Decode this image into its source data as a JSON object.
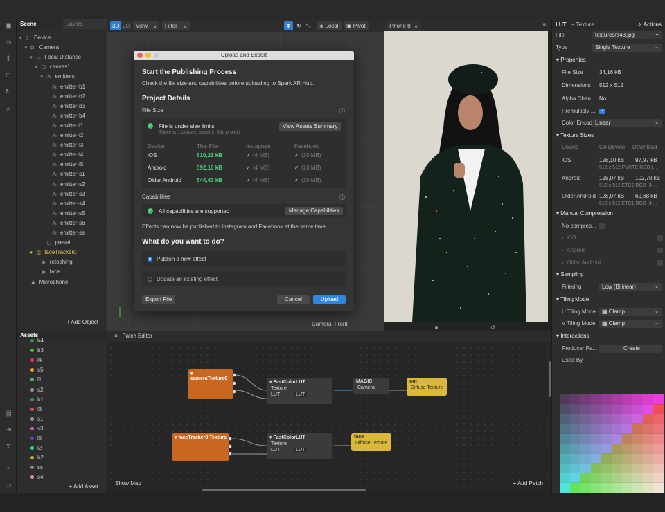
{
  "scene": {
    "tab_scene": "Scene",
    "tab_layers": "Layers",
    "add_object": "+ Add Object",
    "tree": [
      {
        "label": "Device",
        "icon": "device-icon",
        "indent": 0,
        "caret": "▾"
      },
      {
        "label": "Camera",
        "icon": "camera-icon",
        "indent": 1,
        "caret": "▾"
      },
      {
        "label": "Focal Distance",
        "icon": "focal-icon",
        "indent": 2,
        "caret": "▾"
      },
      {
        "label": "canvas1",
        "icon": "canvas-icon",
        "indent": 3,
        "caret": "▾"
      },
      {
        "label": "emitters",
        "icon": "emitter-icon",
        "indent": 4,
        "caret": "▾"
      },
      {
        "label": "emitter-b1",
        "icon": "emitter-icon",
        "indent": 5,
        "caret": ""
      },
      {
        "label": "emitter-b2",
        "icon": "emitter-icon",
        "indent": 5,
        "caret": ""
      },
      {
        "label": "emitter-b3",
        "icon": "emitter-icon",
        "indent": 5,
        "caret": ""
      },
      {
        "label": "emitter-b4",
        "icon": "emitter-icon",
        "indent": 5,
        "caret": ""
      },
      {
        "label": "emitter-l1",
        "icon": "emitter-icon",
        "indent": 5,
        "caret": ""
      },
      {
        "label": "emitter-l2",
        "icon": "emitter-icon",
        "indent": 5,
        "caret": ""
      },
      {
        "label": "emitter-l3",
        "icon": "emitter-icon",
        "indent": 5,
        "caret": ""
      },
      {
        "label": "emitter-l4",
        "icon": "emitter-icon",
        "indent": 5,
        "caret": ""
      },
      {
        "label": "emitter-l5",
        "icon": "emitter-icon",
        "indent": 5,
        "caret": ""
      },
      {
        "label": "emitter-s1",
        "icon": "emitter-icon",
        "indent": 5,
        "caret": ""
      },
      {
        "label": "emitter-s2",
        "icon": "emitter-icon",
        "indent": 5,
        "caret": ""
      },
      {
        "label": "emitter-s3",
        "icon": "emitter-icon",
        "indent": 5,
        "caret": ""
      },
      {
        "label": "emitter-s4",
        "icon": "emitter-icon",
        "indent": 5,
        "caret": ""
      },
      {
        "label": "emitter-s5",
        "icon": "emitter-icon",
        "indent": 5,
        "caret": ""
      },
      {
        "label": "emitter-s6",
        "icon": "emitter-icon",
        "indent": 5,
        "caret": ""
      },
      {
        "label": "emitter-ss",
        "icon": "emitter-icon",
        "indent": 5,
        "caret": ""
      },
      {
        "label": "preset",
        "icon": "preset-icon",
        "indent": 4,
        "caret": ""
      },
      {
        "label": "faceTracker0",
        "icon": "face-tracker-icon",
        "indent": 2,
        "caret": "▾",
        "highlight": true
      },
      {
        "label": "retoching",
        "icon": "mesh-icon",
        "indent": 3,
        "caret": ""
      },
      {
        "label": "face",
        "icon": "mesh-icon",
        "indent": 3,
        "caret": ""
      },
      {
        "label": "Microphone",
        "icon": "microphone-icon",
        "indent": 1,
        "caret": ""
      }
    ]
  },
  "assets": {
    "title": "Assets",
    "add_asset": "+ Add Asset",
    "items": [
      {
        "label": "b4",
        "color": "#3a9a3a"
      },
      {
        "label": "b3",
        "color": "#4fb84f"
      },
      {
        "label": "l4",
        "color": "#e04040"
      },
      {
        "label": "s5",
        "color": "#e8a030"
      },
      {
        "label": "l1",
        "color": "#40c060"
      },
      {
        "label": "s2",
        "color": "#9a9a9a"
      },
      {
        "label": "b1",
        "color": "#3aa03a"
      },
      {
        "label": "l3",
        "color": "#e05050"
      },
      {
        "label": "s1",
        "color": "#9a9a9a"
      },
      {
        "label": "s3",
        "color": "#c060c0"
      },
      {
        "label": "l5",
        "color": "#6040e0"
      },
      {
        "label": "l2",
        "color": "#40d080"
      },
      {
        "label": "b2",
        "color": "#c8a060"
      },
      {
        "label": "ss",
        "color": "#8a8a8a"
      },
      {
        "label": "s4",
        "color": "#e090c0"
      }
    ]
  },
  "viewport": {
    "btn_3d": "3D",
    "btn_2d": "2D",
    "view": "View",
    "filter": "Filter",
    "local": "Local",
    "pivot": "Pivot",
    "camera_label": "Camera: Front",
    "device": "iPhone 8"
  },
  "dialog": {
    "title": "Upload and Export",
    "heading": "Start the Publishing Process",
    "subtitle": "Check the file size and capabilities before uploading to Spark AR Hub.",
    "project_details": "Project Details",
    "file_size": "File Size",
    "size_ok": "File is under size limits",
    "size_note": "There is 1 unused asset in this project",
    "view_assets": "View Assets Summary",
    "col_device": "Device",
    "col_file": "This File",
    "col_instagram": "Instagram",
    "col_facebook": "Facebook",
    "rows": [
      {
        "device": "iOS",
        "size": "610,21 kB",
        "ig": "(4 MB)",
        "fb": "(10 MB)"
      },
      {
        "device": "Android",
        "size": "592,16 kB",
        "ig": "(4 MB)",
        "fb": "(10 MB)"
      },
      {
        "device": "Older Android",
        "size": "544,43 kB",
        "ig": "(4 MB)",
        "fb": "(10 MB)"
      }
    ],
    "capabilities": "Capabilities",
    "cap_ok": "All capabilities are supported",
    "manage_caps": "Manage Capabilities",
    "publish_note": "Effects can now be published to Instagram and Facebook at the same time.",
    "question": "What do you want to do?",
    "opt_new": "Publish a new effect",
    "opt_update": "Update an existing effect",
    "export": "Export File",
    "cancel": "Cancel",
    "upload": "Upload"
  },
  "patch": {
    "title": "Patch Editor",
    "show_map": "Show Map",
    "add_patch": "+ Add Patch",
    "camera_texture": "▾ cameraTexture0",
    "face_texture": "▾ faceTracker0 Texture",
    "fcl": "▾ FastColorLUT",
    "texture": "Texture",
    "lut": "LUT",
    "lut_val": "LUT",
    "magic": "MAGIC",
    "camera": "Camera",
    "out": "out",
    "face": "face",
    "diffuse": "Diffuse Texture"
  },
  "inspector": {
    "title": "LUT",
    "subtitle": "– Texture",
    "actions": "Actions",
    "file_label": "File",
    "file_value": "textures/a43.jpg",
    "type_label": "Type",
    "type_value": "Single Texture",
    "properties": "Properties",
    "file_size_label": "File Size",
    "file_size_value": "34,16 kB",
    "dimensions_label": "Dimensions",
    "dimensions_value": "512 x 512",
    "alpha_label": "Alpha Chan...",
    "alpha_value": "No",
    "premult_label": "Premultiply ...",
    "color_label": "Color Encod...",
    "color_value": "Linear",
    "texture_sizes": "Texture Sizes",
    "ts_device": "Device",
    "ts_on_device": "On Device",
    "ts_download": "Download",
    "ts_rows": [
      {
        "device": "iOS",
        "on": "128,10 kB",
        "dl": "97,97 kB",
        "sub": "512 x 512 PVRTC RGB (..."
      },
      {
        "device": "Android",
        "on": "128,07 kB",
        "dl": "102,70 kB",
        "sub": "512 x 512 ETC2 RGB (4 ..."
      },
      {
        "device": "Older Android",
        "on": "128,07 kB",
        "dl": "69,68 kB",
        "sub": "512 x 512 ETC1 RGB (4 ..."
      }
    ],
    "manual_compression": "Manual Compression",
    "no_compress": "No compres...",
    "mc_ios": "iOS",
    "mc_android": "Android",
    "mc_older": "Older Android",
    "sampling": "Sampling",
    "filtering_label": "Filtering",
    "filtering_value": "Low (Bilinear)",
    "tiling": "Tiling Mode",
    "u_label": "U Tiling Mode",
    "u_value": "Clamp",
    "v_label": "V Tiling Mode",
    "v_value": "Clamp",
    "interactions": "Interactions",
    "producer_label": "Producer Pa...",
    "create": "Create",
    "used_by": "Used By"
  }
}
